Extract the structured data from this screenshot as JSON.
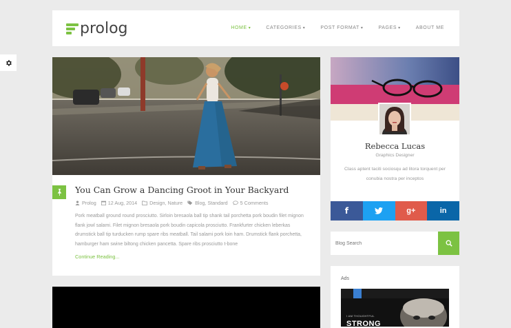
{
  "header": {
    "logo_text": "prolog",
    "nav": [
      {
        "label": "HOME",
        "active": true,
        "has_caret": true
      },
      {
        "label": "CATEGORIES",
        "active": false,
        "has_caret": true
      },
      {
        "label": "POST FORMAT",
        "active": false,
        "has_caret": true
      },
      {
        "label": "PAGES",
        "active": false,
        "has_caret": true
      },
      {
        "label": "ABOUT ME",
        "active": false,
        "has_caret": false
      }
    ]
  },
  "post": {
    "title": "You Can Grow a Dancing Groot in Your Backyard",
    "author": "Prolog",
    "date": "12 Aug, 2014",
    "categories": "Design, Nature",
    "tags": "Blog, Standard",
    "comments": "5 Comments",
    "excerpt": "Pork meatball ground round prosciutto. Sirloin bresaola ball tip shank tail porchetta pork boudin filet mignon flank jowl salami. Filet mignon bresaola pork boudin capicola prosciutto. Frankfurter chicken leberkas drumstick ball tip turducken rump spare ribs meatball. Tail salami pork loin ham. Drumstick flank porchetta, hamburger ham swine biltong chicken pancetta. Spare ribs prosciutto t-bone",
    "read_more": "Continue Reading..."
  },
  "profile": {
    "name": "Rebecca Lucas",
    "role": "Graphics Designer",
    "bio": "Class aptent taciti sociosqu ad litora torquent per conubia nostra per inceptos"
  },
  "social": [
    {
      "name": "facebook",
      "glyph": "f",
      "color": "#3b5998"
    },
    {
      "name": "twitter",
      "glyph": "t",
      "color": "#1da1f2"
    },
    {
      "name": "google-plus",
      "glyph": "g+",
      "color": "#e05b4b"
    },
    {
      "name": "linkedin",
      "glyph": "in",
      "color": "#0a66a8"
    }
  ],
  "search": {
    "placeholder": "Blog Search"
  },
  "ads": {
    "title": "Ads",
    "banner_small": "I AM THOUGHTFUL",
    "banner_big": "STRONG"
  },
  "colors": {
    "accent": "#7cc242"
  }
}
